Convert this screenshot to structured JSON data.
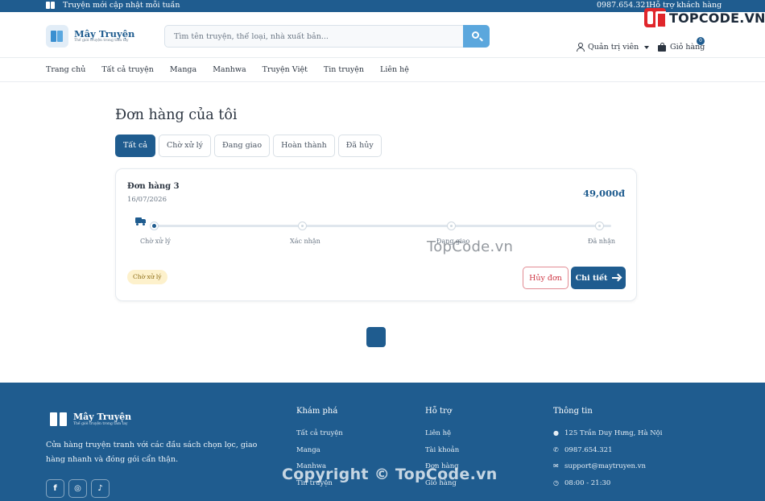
{
  "topbar": {
    "promo": "Truyện mới cập nhật mỗi tuần",
    "phone": "0987.654.321",
    "support": "Hỗ trợ khách hàng"
  },
  "watermark_logo": {
    "text": "TOPCODE.VN"
  },
  "header": {
    "brand_name": "Mây Truyện",
    "brand_tagline": "Thế giới truyện trong tầm tay",
    "search_placeholder": "Tìm tên truyện, thể loại, nhà xuất bản...",
    "account_label": "Quản trị viên",
    "cart_label": "Giỏ hàng",
    "cart_count": "0"
  },
  "nav": {
    "items": [
      "Trang chủ",
      "Tất cả truyện",
      "Manga",
      "Manhwa",
      "Truyện Việt",
      "Tin truyện",
      "Liên hệ"
    ]
  },
  "page": {
    "title": "Đơn hàng của tôi",
    "tabs": [
      "Tất cả",
      "Chờ xử lý",
      "Đang giao",
      "Hoàn thành",
      "Đã hủy"
    ],
    "active_tab": "Tất cả"
  },
  "order": {
    "name": "Đơn hàng 3",
    "date": "16/07/2026",
    "total": "49,000đ",
    "steps": [
      "Chờ xử lý",
      "Xác nhận",
      "Đang giao",
      "Đã nhận"
    ],
    "current_step": 0,
    "status": "Chờ xử lý",
    "cancel_label": "Hủy đơn",
    "detail_label": "Chi tiết"
  },
  "watermark_center": "TopCode.vn",
  "footer": {
    "brand_name": "Mây Truyện",
    "brand_tagline": "Thế giới truyện trong tầm tay",
    "description": "Cửa hàng truyện tranh với các đầu sách chọn lọc, giao hàng nhanh và đóng gói cẩn thận.",
    "social": [
      "f",
      "◎",
      "♪"
    ],
    "explore": {
      "title": "Khám phá",
      "links": [
        "Tất cả truyện",
        "Manga",
        "Manhwa",
        "Tin truyện"
      ]
    },
    "help": {
      "title": "Hỗ trợ",
      "links": [
        "Liên hệ",
        "Tài khoản",
        "Đơn hàng",
        "Giỏ hàng"
      ]
    },
    "info": {
      "title": "Thông tin",
      "address": "125 Trần Duy Hưng, Hà Nội",
      "phone": "0987.654.321",
      "email": "support@maytruyen.vn",
      "hours": "08:00 - 21:30"
    },
    "watermark": "Copyright © TopCode.vn"
  },
  "colors": {
    "primary": "#1f5c8f",
    "search_button": "#5ba7dd",
    "cancel": "#cf3946",
    "pending_bg": "#fdf1cc"
  }
}
